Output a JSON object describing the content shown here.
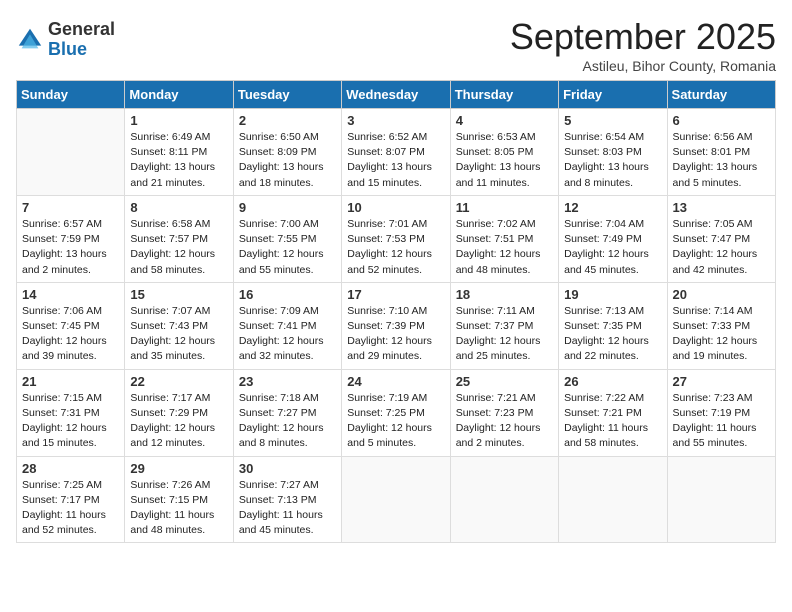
{
  "logo": {
    "general": "General",
    "blue": "Blue"
  },
  "title": "September 2025",
  "subtitle": "Astileu, Bihor County, Romania",
  "days_of_week": [
    "Sunday",
    "Monday",
    "Tuesday",
    "Wednesday",
    "Thursday",
    "Friday",
    "Saturday"
  ],
  "weeks": [
    [
      {
        "day": "",
        "info": ""
      },
      {
        "day": "1",
        "info": "Sunrise: 6:49 AM\nSunset: 8:11 PM\nDaylight: 13 hours and 21 minutes."
      },
      {
        "day": "2",
        "info": "Sunrise: 6:50 AM\nSunset: 8:09 PM\nDaylight: 13 hours and 18 minutes."
      },
      {
        "day": "3",
        "info": "Sunrise: 6:52 AM\nSunset: 8:07 PM\nDaylight: 13 hours and 15 minutes."
      },
      {
        "day": "4",
        "info": "Sunrise: 6:53 AM\nSunset: 8:05 PM\nDaylight: 13 hours and 11 minutes."
      },
      {
        "day": "5",
        "info": "Sunrise: 6:54 AM\nSunset: 8:03 PM\nDaylight: 13 hours and 8 minutes."
      },
      {
        "day": "6",
        "info": "Sunrise: 6:56 AM\nSunset: 8:01 PM\nDaylight: 13 hours and 5 minutes."
      }
    ],
    [
      {
        "day": "7",
        "info": "Sunrise: 6:57 AM\nSunset: 7:59 PM\nDaylight: 13 hours and 2 minutes."
      },
      {
        "day": "8",
        "info": "Sunrise: 6:58 AM\nSunset: 7:57 PM\nDaylight: 12 hours and 58 minutes."
      },
      {
        "day": "9",
        "info": "Sunrise: 7:00 AM\nSunset: 7:55 PM\nDaylight: 12 hours and 55 minutes."
      },
      {
        "day": "10",
        "info": "Sunrise: 7:01 AM\nSunset: 7:53 PM\nDaylight: 12 hours and 52 minutes."
      },
      {
        "day": "11",
        "info": "Sunrise: 7:02 AM\nSunset: 7:51 PM\nDaylight: 12 hours and 48 minutes."
      },
      {
        "day": "12",
        "info": "Sunrise: 7:04 AM\nSunset: 7:49 PM\nDaylight: 12 hours and 45 minutes."
      },
      {
        "day": "13",
        "info": "Sunrise: 7:05 AM\nSunset: 7:47 PM\nDaylight: 12 hours and 42 minutes."
      }
    ],
    [
      {
        "day": "14",
        "info": "Sunrise: 7:06 AM\nSunset: 7:45 PM\nDaylight: 12 hours and 39 minutes."
      },
      {
        "day": "15",
        "info": "Sunrise: 7:07 AM\nSunset: 7:43 PM\nDaylight: 12 hours and 35 minutes."
      },
      {
        "day": "16",
        "info": "Sunrise: 7:09 AM\nSunset: 7:41 PM\nDaylight: 12 hours and 32 minutes."
      },
      {
        "day": "17",
        "info": "Sunrise: 7:10 AM\nSunset: 7:39 PM\nDaylight: 12 hours and 29 minutes."
      },
      {
        "day": "18",
        "info": "Sunrise: 7:11 AM\nSunset: 7:37 PM\nDaylight: 12 hours and 25 minutes."
      },
      {
        "day": "19",
        "info": "Sunrise: 7:13 AM\nSunset: 7:35 PM\nDaylight: 12 hours and 22 minutes."
      },
      {
        "day": "20",
        "info": "Sunrise: 7:14 AM\nSunset: 7:33 PM\nDaylight: 12 hours and 19 minutes."
      }
    ],
    [
      {
        "day": "21",
        "info": "Sunrise: 7:15 AM\nSunset: 7:31 PM\nDaylight: 12 hours and 15 minutes."
      },
      {
        "day": "22",
        "info": "Sunrise: 7:17 AM\nSunset: 7:29 PM\nDaylight: 12 hours and 12 minutes."
      },
      {
        "day": "23",
        "info": "Sunrise: 7:18 AM\nSunset: 7:27 PM\nDaylight: 12 hours and 8 minutes."
      },
      {
        "day": "24",
        "info": "Sunrise: 7:19 AM\nSunset: 7:25 PM\nDaylight: 12 hours and 5 minutes."
      },
      {
        "day": "25",
        "info": "Sunrise: 7:21 AM\nSunset: 7:23 PM\nDaylight: 12 hours and 2 minutes."
      },
      {
        "day": "26",
        "info": "Sunrise: 7:22 AM\nSunset: 7:21 PM\nDaylight: 11 hours and 58 minutes."
      },
      {
        "day": "27",
        "info": "Sunrise: 7:23 AM\nSunset: 7:19 PM\nDaylight: 11 hours and 55 minutes."
      }
    ],
    [
      {
        "day": "28",
        "info": "Sunrise: 7:25 AM\nSunset: 7:17 PM\nDaylight: 11 hours and 52 minutes."
      },
      {
        "day": "29",
        "info": "Sunrise: 7:26 AM\nSunset: 7:15 PM\nDaylight: 11 hours and 48 minutes."
      },
      {
        "day": "30",
        "info": "Sunrise: 7:27 AM\nSunset: 7:13 PM\nDaylight: 11 hours and 45 minutes."
      },
      {
        "day": "",
        "info": ""
      },
      {
        "day": "",
        "info": ""
      },
      {
        "day": "",
        "info": ""
      },
      {
        "day": "",
        "info": ""
      }
    ]
  ]
}
